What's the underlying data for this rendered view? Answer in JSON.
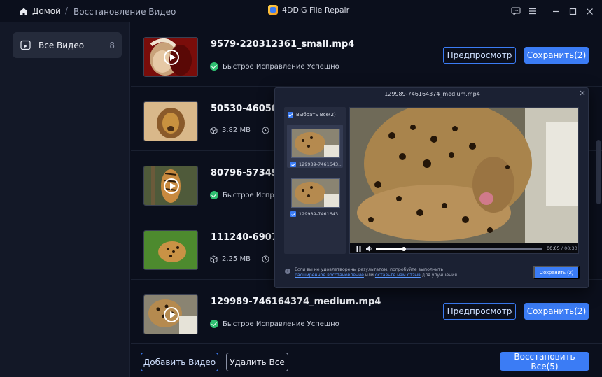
{
  "titlebar": {
    "home": "Домой",
    "separator": "/",
    "breadcrumb": "Восстановление Видео",
    "app_title": "4DDiG File Repair"
  },
  "sidebar": {
    "items": [
      {
        "label": "Все Видео",
        "count": "8"
      }
    ]
  },
  "videos": [
    {
      "name": "9579-220312361_small.mp4",
      "status": "Быстрое Исправление Успешно",
      "preview": "Предпросмотр",
      "save": "Сохранить(2)"
    },
    {
      "name": "50530-4605094",
      "size": "3.82 MB",
      "duration": "00"
    },
    {
      "name": "80796-5734962",
      "status": "Быстрое Исправле"
    },
    {
      "name": "111240-690770",
      "size": "2.25 MB",
      "duration": "00"
    },
    {
      "name": "129989-746164374_medium.mp4",
      "status": "Быстрое Исправление Успешно",
      "preview": "Предпросмотр",
      "save": "Сохранить(2)"
    }
  ],
  "bottom": {
    "add": "Добавить Видео",
    "delete_all": "Удалить Все",
    "restore_all": "Восстановить Все(5)"
  },
  "popup": {
    "title": "129989-746164374_medium.mp4",
    "select_all": "Выбрать Все(2)",
    "items": [
      {
        "label": "129989-7461643..."
      },
      {
        "label": "129989-7461643..."
      }
    ],
    "time_current": "00:05",
    "time_total": "00:30",
    "progress": 0.17,
    "info_text": "Если вы не удовлетворены результатом, попробуйте выполнить",
    "info_link1": "расширенное восстановление",
    "info_or": "или",
    "info_link2": "оставьте нам отзыв",
    "info_tail": "для улучшения",
    "save": "Сохранить (2)"
  },
  "colors": {
    "accent": "#3b7cf5",
    "success": "#2fbf71",
    "background": "#0b0f1c"
  }
}
